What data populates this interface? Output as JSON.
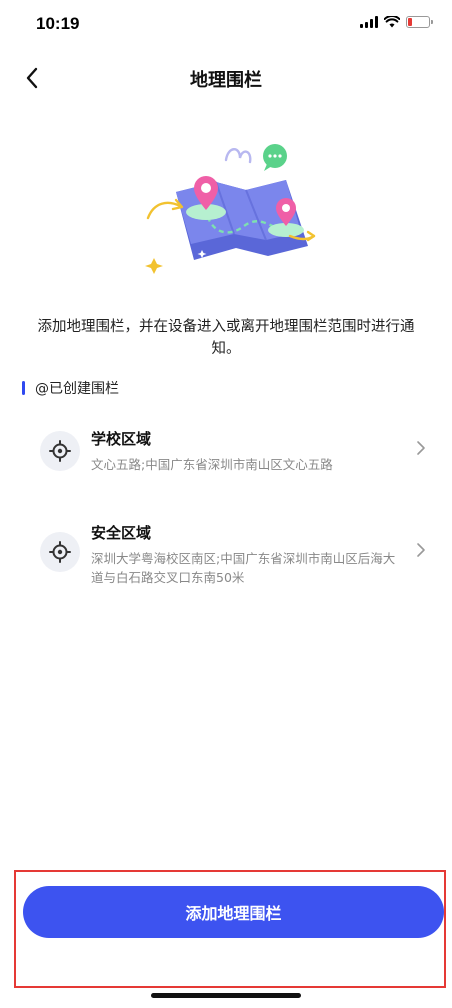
{
  "status_bar": {
    "time": "10:19"
  },
  "header": {
    "title": "地理围栏"
  },
  "intro": {
    "text": "添加地理围栏，并在设备进入或离开地理围栏范围时进行通知。"
  },
  "section": {
    "title": "@已创建围栏"
  },
  "fences": [
    {
      "name": "学校区域",
      "address": "文心五路;中国广东省深圳市南山区文心五路",
      "icon": "target-location-icon"
    },
    {
      "name": "安全区域",
      "address": "深圳大学粤海校区南区;中国广东省深圳市南山区后海大道与白石路交叉口东南50米",
      "icon": "target-location-icon"
    }
  ],
  "bottom": {
    "add_button_label": "添加地理围栏"
  },
  "colors": {
    "accent": "#3d53f0",
    "highlight": "#e53935"
  }
}
